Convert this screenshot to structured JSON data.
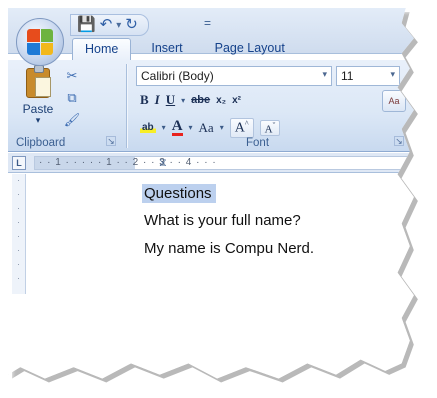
{
  "quick_access": {
    "save_icon": "save-icon",
    "undo_icon": "undo-icon",
    "undo_dropdown": "▾",
    "redo_icon": "redo-icon",
    "customize": "="
  },
  "tabs": [
    {
      "label": "Home",
      "active": true
    },
    {
      "label": "Insert",
      "active": false
    },
    {
      "label": "Page Layout",
      "active": false
    }
  ],
  "ribbon": {
    "clipboard": {
      "paste_label": "Paste",
      "group_label": "Clipboard"
    },
    "font": {
      "font_name": "Calibri (Body)",
      "font_size": "11",
      "bold": "B",
      "italic": "I",
      "underline": "U",
      "strikethrough": "abe",
      "subscript": "x₂",
      "superscript": "x²",
      "highlight": "ab",
      "font_color": "A",
      "change_case": "Aa",
      "grow_font": "A",
      "shrink_font": "A",
      "group_label": "Font"
    }
  },
  "ruler": {
    "marks": "· · 1 · · ·  · · 1 · · 2 · · 3 · · 4 · · ·"
  },
  "document": {
    "lines": [
      "Questions",
      "What is your full name?",
      "My name is Compu Nerd."
    ]
  },
  "colors": {
    "ribbon_top": "#e9f0fa",
    "ribbon_bottom": "#c8d9ef",
    "tab_text": "#15428b",
    "selection": "#bcd0ee",
    "font_color_bar": "#e8231e",
    "highlight_bar": "#f7ee27"
  }
}
